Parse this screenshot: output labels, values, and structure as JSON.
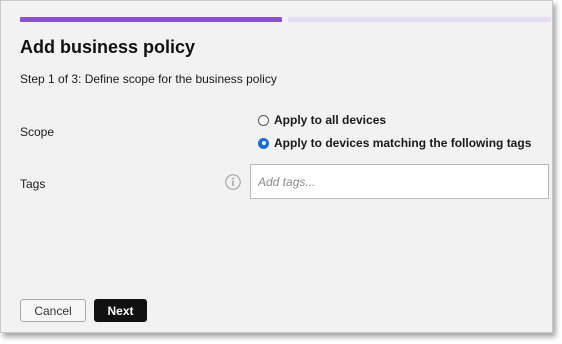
{
  "dialog": {
    "title": "Add business policy",
    "step_text": "Step 1 of 3: Define scope for the business policy",
    "progress": {
      "current_step": 1,
      "total_steps": 3,
      "active_color": "#8a4fe0",
      "inactive_color": "#e6dcf5"
    }
  },
  "scope": {
    "label": "Scope",
    "options": [
      {
        "label": "Apply to all devices",
        "selected": false
      },
      {
        "label": "Apply to devices matching the following tags",
        "selected": true
      }
    ]
  },
  "tags": {
    "label": "Tags",
    "info_icon": "info-icon",
    "placeholder": "Add tags...",
    "value": ""
  },
  "footer": {
    "cancel_label": "Cancel",
    "next_label": "Next"
  }
}
